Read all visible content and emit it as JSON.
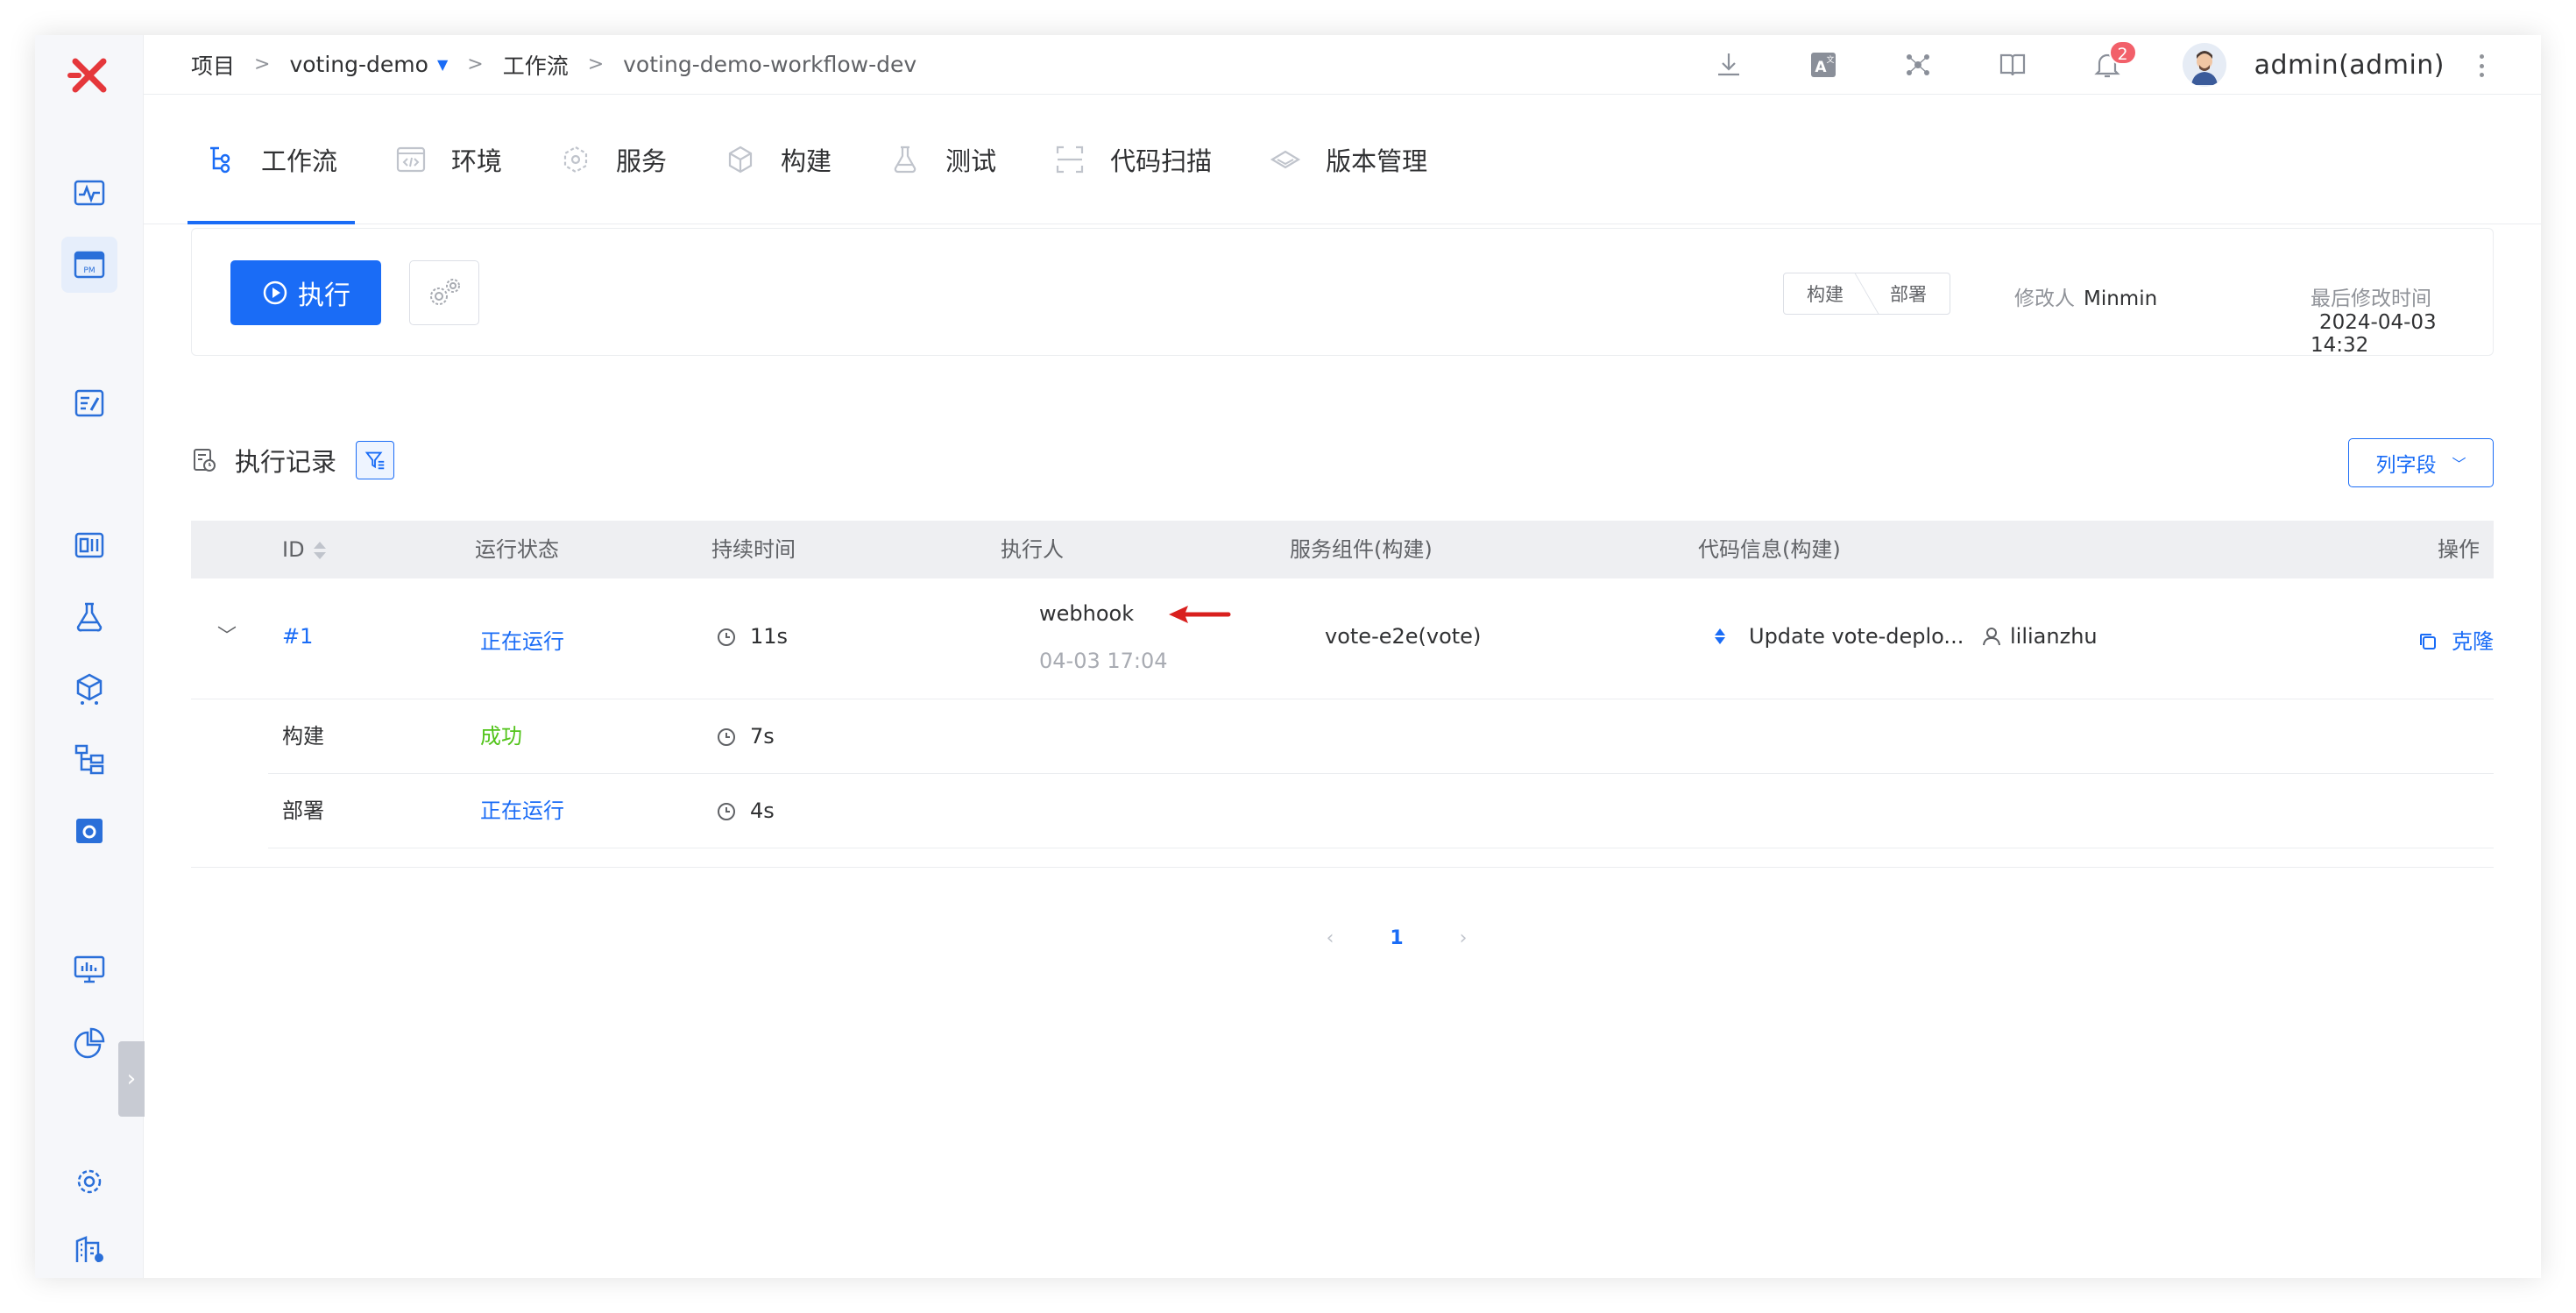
{
  "breadcrumb": {
    "root": "项目",
    "project": "voting-demo",
    "section": "工作流",
    "workflow": "voting-demo-workflow-dev"
  },
  "header": {
    "user": "admin(admin)",
    "notification_count": "2"
  },
  "tabs": [
    {
      "label": "工作流",
      "icon": "workflow-icon"
    },
    {
      "label": "环境",
      "icon": "environment-icon"
    },
    {
      "label": "服务",
      "icon": "service-icon"
    },
    {
      "label": "构建",
      "icon": "build-icon"
    },
    {
      "label": "测试",
      "icon": "test-icon"
    },
    {
      "label": "代码扫描",
      "icon": "scan-icon"
    },
    {
      "label": "版本管理",
      "icon": "version-icon"
    }
  ],
  "toolbar": {
    "run_label": "执行",
    "stages": [
      "构建",
      "部署"
    ],
    "modifier_label": "修改人",
    "modifier": "Minmin",
    "modified_label": "最后修改时间",
    "modified_time": "2024-04-03 14:32"
  },
  "records": {
    "title": "执行记录",
    "columns_button": "列字段"
  },
  "table": {
    "headers": {
      "id": "ID",
      "status": "运行状态",
      "duration": "持续时间",
      "executor": "执行人",
      "service": "服务组件(构建)",
      "code": "代码信息(构建)",
      "action": "操作"
    },
    "row": {
      "id": "#1",
      "status": "正在运行",
      "duration": "11s",
      "executor": "webhook",
      "time": "04-03 17:04",
      "service": "vote-e2e(vote)",
      "commit": "Update vote-deplo...",
      "author": "lilianzhu",
      "action": "克隆"
    },
    "stages": [
      {
        "name": "构建",
        "status": "成功",
        "duration": "7s"
      },
      {
        "name": "部署",
        "status": "正在运行",
        "duration": "4s"
      }
    ]
  },
  "pagination": {
    "current": "1"
  },
  "colors": {
    "primary": "#1a6cf6",
    "success": "#52c41a",
    "arrow": "#d9201e",
    "badge": "#f2606a"
  }
}
